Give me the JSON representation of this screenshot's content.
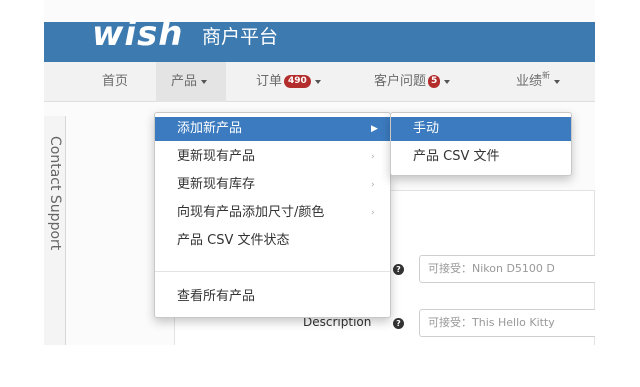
{
  "header": {
    "logo": "wish",
    "title": "商户平台"
  },
  "nav": {
    "home": "首页",
    "products": "产品",
    "orders": "订单",
    "orders_badge": "490",
    "customer_issues": "客户问题",
    "customer_issues_badge": "5",
    "performance": "业绩",
    "performance_sup": "新"
  },
  "side_tab": {
    "label": "Contact Support"
  },
  "dropdown": {
    "items": [
      {
        "label": "添加新产品"
      },
      {
        "label": "更新现有产品"
      },
      {
        "label": "更新现有库存"
      },
      {
        "label": "向现有产品添加尺寸/颜色"
      },
      {
        "label": "产品 CSV 文件状态"
      },
      {
        "label": "查看所有产品"
      }
    ]
  },
  "submenu": {
    "items": [
      {
        "label": "手动"
      },
      {
        "label": "产品 CSV 文件"
      }
    ]
  },
  "form": {
    "description_label": "Description",
    "name_placeholder": "可接受：Nikon D5100 D",
    "description_placeholder": "可接受：This Hello Kitty"
  },
  "icons": {
    "submenu_arrow": "chevron-right-icon",
    "help": "question-circle-icon",
    "caret": "caret-down-icon"
  },
  "colors": {
    "header_bg": "#3d7ab0",
    "highlight": "#3c7bbf",
    "badge": "#b42d2d"
  }
}
